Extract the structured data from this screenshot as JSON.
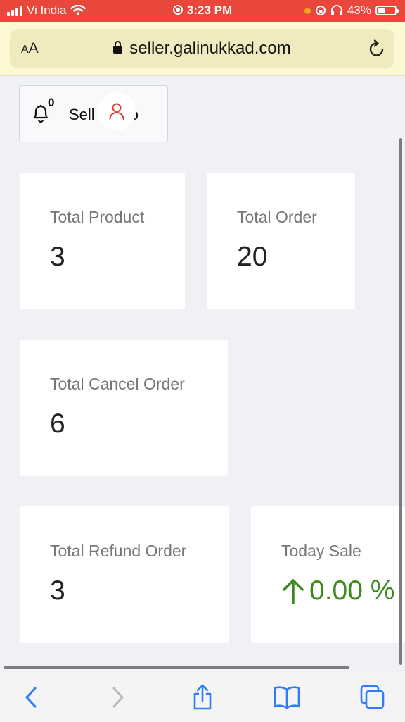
{
  "status_bar": {
    "carrier": "Vi India",
    "time": "3:23 PM",
    "battery_percent": "43%",
    "signal_bars": 4,
    "battery_level": 0.43
  },
  "browser": {
    "text_size_label_small": "A",
    "text_size_label_large": "A",
    "url": "seller.galinukkad.com",
    "icons": [
      "lock-icon",
      "reload-icon",
      "back-icon",
      "forward-icon",
      "share-icon",
      "bookmarks-icon",
      "tabs-icon"
    ]
  },
  "header": {
    "notification_count": "0",
    "seller_label_left": "Sell",
    "seller_label_right": "fo"
  },
  "stats": {
    "total_product": {
      "label": "Total Product",
      "value": "3"
    },
    "total_order": {
      "label": "Total Order",
      "value": "20"
    },
    "total_cancel_order": {
      "label": "Total Cancel Order",
      "value": "6"
    },
    "total_refund_order": {
      "label": "Total Refund Order",
      "value": "3"
    },
    "today_sale": {
      "label": "Today Sale",
      "value": "0.00 %",
      "trend": "up",
      "color": "#3d8a1f"
    }
  },
  "colors": {
    "status_bar": "#e9463c",
    "url_bar": "#fbf8d2",
    "accent_blue": "#2f7cf6",
    "avatar_red": "#d9433a",
    "page_bg": "#eff1f4"
  }
}
